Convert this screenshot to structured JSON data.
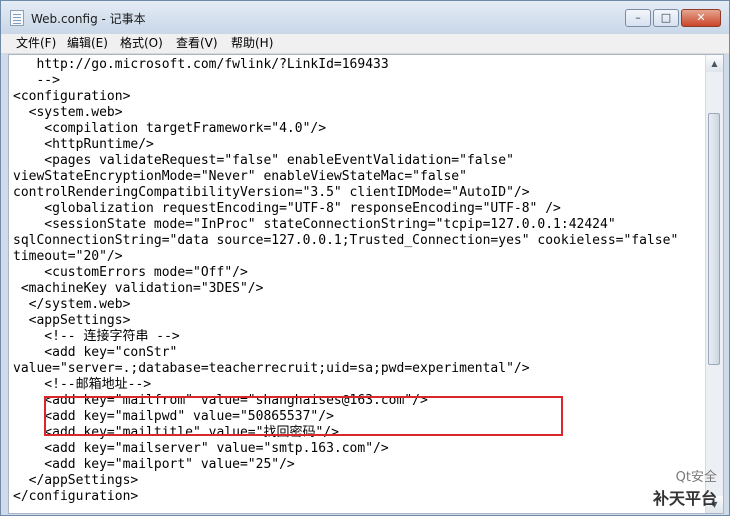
{
  "window": {
    "title": "Web.config - 记事本",
    "minimize_glyph": "–",
    "maximize_glyph": "□",
    "close_glyph": "✕"
  },
  "menu": [
    "文件(F)",
    "编辑(E)",
    "格式(O)",
    "查看(V)",
    "帮助(H)"
  ],
  "editor": {
    "lines": [
      "   http://go.microsoft.com/fwlink/?LinkId=169433",
      "   -->",
      "<configuration>",
      "  <system.web>",
      "    <compilation targetFramework=\"4.0\"/>",
      "    <httpRuntime/>",
      "    <pages validateRequest=\"false\" enableEventValidation=\"false\"",
      "viewStateEncryptionMode=\"Never\" enableViewStateMac=\"false\"",
      "controlRenderingCompatibilityVersion=\"3.5\" clientIDMode=\"AutoID\"/>",
      "    <globalization requestEncoding=\"UTF-8\" responseEncoding=\"UTF-8\" />",
      "    <sessionState mode=\"InProc\" stateConnectionString=\"tcpip=127.0.0.1:42424\"",
      "sqlConnectionString=\"data source=127.0.0.1;Trusted_Connection=yes\" cookieless=\"false\"",
      "timeout=\"20\"/>",
      "    <customErrors mode=\"Off\"/>",
      " <machineKey validation=\"3DES\"/>",
      "  </system.web>",
      "  <appSettings>",
      "    <!-- 连接字符串 -->",
      "    <add key=\"conStr\"",
      "value=\"server=.;database=teacherrecruit;uid=sa;pwd=experimental\"/>",
      "    <!--邮箱地址-->",
      "    <add key=\"mailfrom\" value=\"shanghaises@163.com\"/>",
      "    <add key=\"mailpwd\" value=\"50865537\"/>",
      "    <add key=\"mailtitle\" value=\"找回密码\"/>",
      "    <add key=\"mailserver\" value=\"smtp.163.com\"/>",
      "    <add key=\"mailport\" value=\"25\"/>",
      "  </appSettings>",
      "</configuration>"
    ]
  },
  "watermark": {
    "line1": "Qt安全",
    "line2": "补天平台"
  }
}
